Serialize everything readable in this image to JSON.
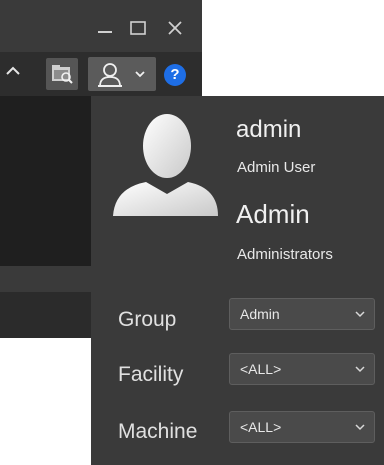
{
  "window": {
    "minimize_icon": "minimize-icon",
    "maximize_icon": "maximize-icon",
    "close_icon": "close-icon"
  },
  "toolbar": {
    "collapse_icon": "chevron-up-icon",
    "folder_icon": "folder-search-icon",
    "user_icon": "user-icon",
    "user_menu_icon": "chevron-down-icon",
    "help_label": "?"
  },
  "user_panel": {
    "avatar_icon": "user-avatar-icon",
    "username": "admin",
    "full_name": "Admin User",
    "role": "Admin",
    "group_membership": "Administrators"
  },
  "fields": {
    "group": {
      "label": "Group",
      "value": "Admin"
    },
    "facility": {
      "label": "Facility",
      "value": "<ALL>"
    },
    "machine": {
      "label": "Machine",
      "value": "<ALL>"
    }
  },
  "colors": {
    "panel_bg": "#3a3a3a",
    "help_blue": "#1e6ee6",
    "text": "#f0f0f0"
  }
}
